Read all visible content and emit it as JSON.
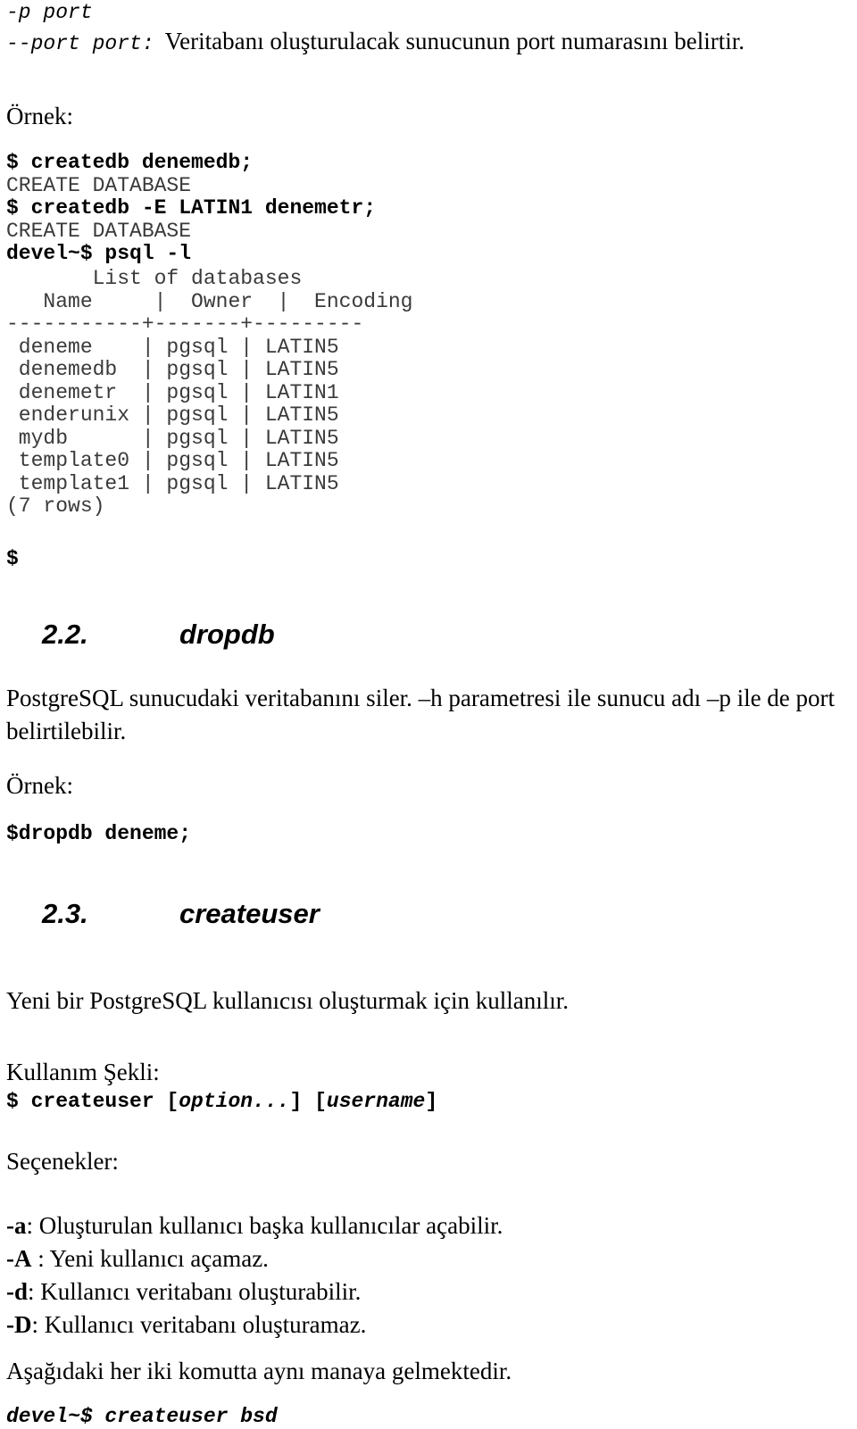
{
  "doc": {
    "top_option": {
      "short_flag": "-p port",
      "long_flag": "--port port:",
      "description": "Veritabanı oluşturulacak sunucunun port numarasını belirtir."
    },
    "example_label_1": "Örnek:",
    "createdb_session": [
      {
        "text": "$ createdb denemedb;",
        "style": "bold"
      },
      {
        "text": "CREATE DATABASE",
        "style": "plain"
      },
      {
        "text": "$ createdb -E LATIN1 denemetr;",
        "style": "bold"
      },
      {
        "text": "CREATE DATABASE",
        "style": "plain"
      },
      {
        "text": "devel~$ psql -l",
        "style": "bold"
      }
    ],
    "psql_output": {
      "title": "       List of databases",
      "header": "   Name     |  Owner  |  Encoding",
      "separator": "-----------+-------+---------",
      "rows": [
        " deneme    | pgsql | LATIN5",
        " denemedb  | pgsql | LATIN5",
        " denemetr  | pgsql | LATIN1",
        " enderunix | pgsql | LATIN5",
        " mydb      | pgsql | LATIN5",
        " template0 | pgsql | LATIN5",
        " template1 | pgsql | LATIN5"
      ],
      "row_count": "(7 rows)",
      "trailing_prompt": "$"
    },
    "section_dropdb": {
      "number": "2.2.",
      "title": "dropdb",
      "paragraph": "PostgreSQL sunucudaki veritabanını siler. –h parametresi ile sunucu adı –p ile de port belirtilebilir.",
      "example_label": "Örnek:",
      "command": "$dropdb deneme;"
    },
    "section_createuser": {
      "number": "2.3.",
      "title": "createuser",
      "paragraph": "Yeni bir PostgreSQL kullanıcısı oluşturmak için kullanılır.",
      "usage_label": "Kullanım Şekli:",
      "usage_parts": {
        "prefix": "$ createuser [",
        "option": "option...",
        "middle": "] [",
        "username": "username",
        "suffix": "]"
      },
      "options_label": "Seçenekler:",
      "options": [
        {
          "flag": "-a",
          "desc": ": Oluşturulan kullanıcı başka kullanıcılar açabilir."
        },
        {
          "flag": "-A",
          "desc": " : Yeni kullanıcı açamaz."
        },
        {
          "flag": "-d",
          "desc": ":  Kullanıcı veritabanı oluşturabilir."
        },
        {
          "flag": "-D",
          "desc": ": Kullanıcı veritabanı oluşturamaz."
        }
      ],
      "note": "Aşağıdaki her iki komutta aynı manaya gelmektedir.",
      "final_command": "devel~$ createuser bsd"
    }
  }
}
